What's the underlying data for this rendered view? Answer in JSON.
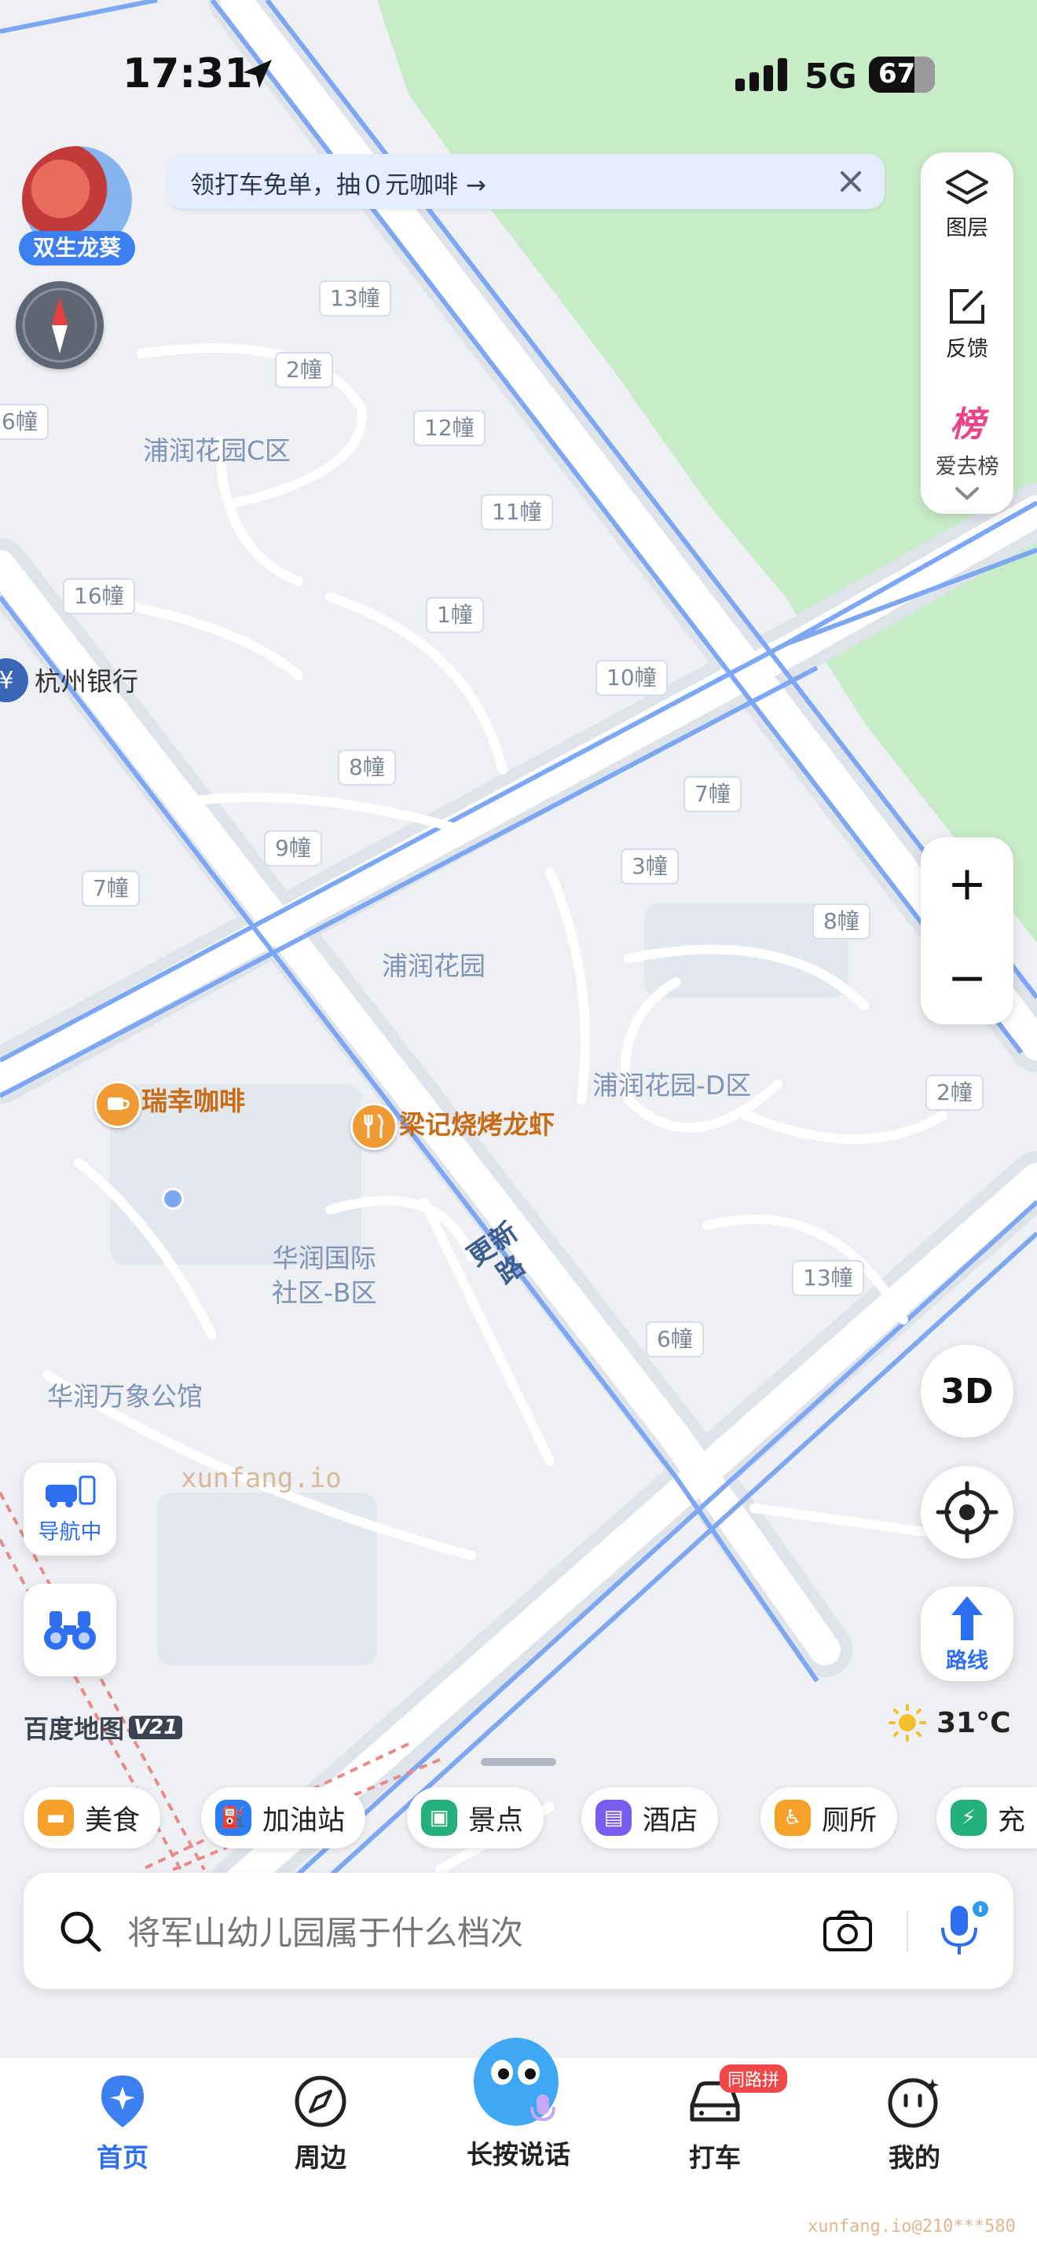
{
  "status_bar": {
    "time": "17:31",
    "network": "5G",
    "battery": "67"
  },
  "promo_banner": {
    "text": "领打车免单，抽０元咖啡 →"
  },
  "avatar": {
    "badge": "双生龙葵"
  },
  "right_panel": {
    "layers_label": "图层",
    "feedback_label": "反馈",
    "rank_label": "爱去榜",
    "rank_icon_text": "榜"
  },
  "map": {
    "buildings": [
      "13幢",
      "2幢",
      "12幢",
      "11幢",
      "16幢",
      "1幢",
      "10幢",
      "8幢",
      "7幢",
      "9幢",
      "7幢",
      "3幢",
      "8幢",
      "2幢",
      "13幢",
      "6幢",
      "6幢"
    ],
    "areas": [
      "浦润花园C区",
      "浦润花园",
      "浦润花园-D区",
      "华润国际\n社区-B区",
      "华润万象公馆"
    ],
    "bank": "杭州银行",
    "bank_icon": "¥",
    "road": "更新路",
    "pois": [
      "瑞幸咖啡",
      "梁记烧烤龙虾"
    ],
    "watermark": "xunfang.io",
    "logo": "百度地图",
    "logo_version": "V21",
    "weather": "31°C",
    "footer_mark": "xunfang.io@210***580"
  },
  "controls": {
    "zoom_in": "+",
    "zoom_out": "−",
    "view_3d": "3D",
    "navigating": "导航中",
    "route": "路线"
  },
  "categories": [
    {
      "label": "美食",
      "color": "#f5a12a"
    },
    {
      "label": "加油站",
      "color": "#2a7df5"
    },
    {
      "label": "景点",
      "color": "#23b07a"
    },
    {
      "label": "酒店",
      "color": "#7a5cf0"
    },
    {
      "label": "厕所",
      "color": "#f5a12a"
    },
    {
      "label": "充",
      "color": "#23b07a"
    }
  ],
  "search": {
    "placeholder": "将军山幼儿园属于什么档次"
  },
  "tabs": [
    {
      "label": "首页"
    },
    {
      "label": "周边"
    },
    {
      "label": "长按说话"
    },
    {
      "label": "打车",
      "badge": "同路拼"
    },
    {
      "label": "我的"
    }
  ]
}
